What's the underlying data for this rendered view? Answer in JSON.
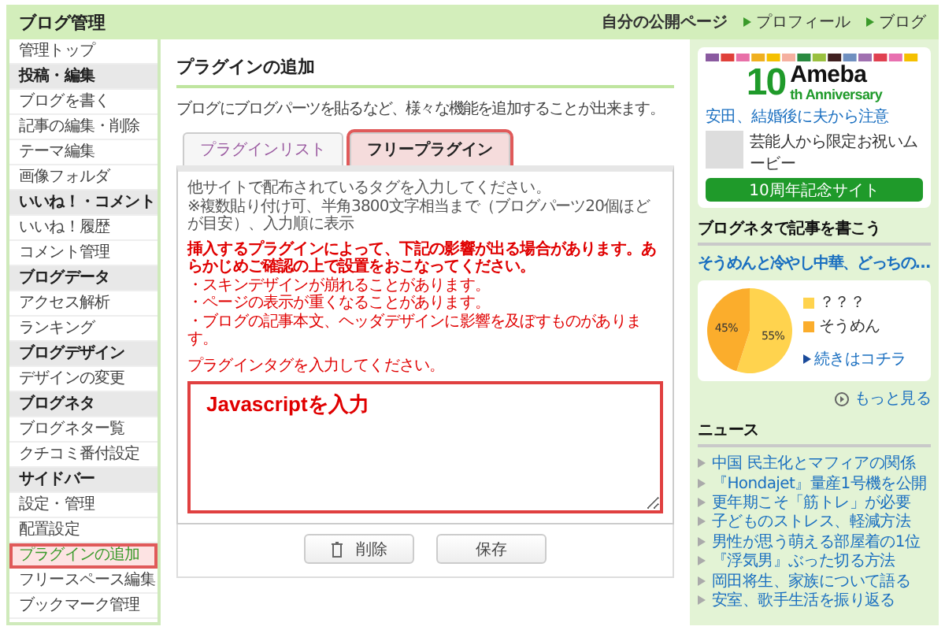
{
  "header": {
    "title": "ブログ管理",
    "links": [
      {
        "label": "自分の公開ページ",
        "kind": "plain"
      },
      {
        "label": "プロフィール",
        "kind": "arrow"
      },
      {
        "label": "ブログ",
        "kind": "arrow"
      }
    ]
  },
  "sidebar": {
    "items": [
      {
        "label": "管理トップ",
        "kind": "link",
        "selected": false,
        "highlighted": false
      },
      {
        "label": "投稿・編集",
        "kind": "header",
        "selected": false,
        "highlighted": false
      },
      {
        "label": "ブログを書く",
        "kind": "link",
        "selected": false,
        "highlighted": false
      },
      {
        "label": "記事の編集・削除",
        "kind": "link",
        "selected": false,
        "highlighted": false
      },
      {
        "label": "テーマ編集",
        "kind": "link",
        "selected": false,
        "highlighted": false
      },
      {
        "label": "画像フォルダ",
        "kind": "link",
        "selected": false,
        "highlighted": false
      },
      {
        "label": "いいね！・コメント",
        "kind": "header",
        "selected": false,
        "highlighted": false
      },
      {
        "label": "いいね！履歴",
        "kind": "link",
        "selected": false,
        "highlighted": false
      },
      {
        "label": "コメント管理",
        "kind": "link",
        "selected": false,
        "highlighted": false
      },
      {
        "label": "ブログデータ",
        "kind": "header",
        "selected": false,
        "highlighted": false
      },
      {
        "label": "アクセス解析",
        "kind": "link",
        "selected": false,
        "highlighted": false
      },
      {
        "label": "ランキング",
        "kind": "link",
        "selected": false,
        "highlighted": false
      },
      {
        "label": "ブログデザイン",
        "kind": "header",
        "selected": false,
        "highlighted": false
      },
      {
        "label": "デザインの変更",
        "kind": "link",
        "selected": false,
        "highlighted": false
      },
      {
        "label": "ブログネタ",
        "kind": "header",
        "selected": false,
        "highlighted": false
      },
      {
        "label": "ブログネター覧",
        "kind": "link",
        "selected": false,
        "highlighted": false
      },
      {
        "label": "クチコミ番付設定",
        "kind": "link",
        "selected": false,
        "highlighted": false
      },
      {
        "label": "サイドバー",
        "kind": "header",
        "selected": false,
        "highlighted": false
      },
      {
        "label": "設定・管理",
        "kind": "link",
        "selected": false,
        "highlighted": false
      },
      {
        "label": "配置設定",
        "kind": "link",
        "selected": false,
        "highlighted": false
      },
      {
        "label": "プラグインの追加",
        "kind": "link",
        "selected": true,
        "highlighted": true
      },
      {
        "label": "フリースペース編集",
        "kind": "link",
        "selected": false,
        "highlighted": false
      },
      {
        "label": "ブックマーク管理",
        "kind": "link",
        "selected": false,
        "highlighted": false
      }
    ]
  },
  "main": {
    "title": "プラグインの追加",
    "description": "ブログにブログパーツを貼るなど、様々な機能を追加することが出来ます。",
    "tabs": [
      {
        "label": "プラグインリスト",
        "selected": false,
        "highlighted": false
      },
      {
        "label": "フリープラグイン",
        "selected": true,
        "highlighted": true
      }
    ],
    "instructions": [
      "他サイトで配布されているタグを入力してください。",
      "※複数貼り付け可、半角3800文字相当まで（ブログパーツ20個ほどが目安）、入力順に表示"
    ],
    "warning": {
      "heading": "挿入するプラグインによって、下記の影響が出る場合があります。あらかじめご確認の上で設置をおこなってください。",
      "items": [
        "・スキンデザインが崩れることがあります。",
        "・ページの表示が重くなることがあります。",
        "・ブログの記事本文、ヘッダデザインに影響を及ぼすものがあります。"
      ]
    },
    "prompt": "プラグインタグを入力してください。",
    "editor": {
      "value": "Javascriptを入力",
      "highlighted": true
    },
    "buttons": [
      {
        "label": "削除",
        "kind": "delete"
      },
      {
        "label": "保存",
        "kind": "save"
      }
    ]
  },
  "right": {
    "banner": {
      "logo_number": "10",
      "logo_name": "Ameba",
      "logo_sub": "th Anniversary",
      "headline": "安田、結婚後に夫から注意",
      "caption": "芸能人から限定お祝いムービー",
      "button": "10周年記念サイト"
    },
    "neta": {
      "heading": "ブログネタで記事を書こう",
      "topic": "そうめんと冷やし中華、どっちの…",
      "chart_data": {
        "type": "pie",
        "legend": "right",
        "categories": [
          "？？？",
          "そうめん"
        ],
        "values": [
          55,
          45
        ],
        "colors": [
          "#ffd34e",
          "#fbad2c"
        ],
        "value_labels": [
          "55%",
          "45%"
        ]
      },
      "more_link": "続きはコチラ"
    },
    "more": "もっと見る",
    "news": {
      "heading": "ニュース",
      "items": [
        "中国 民主化とマフィアの関係",
        "『Hondajet』量産1号機を公開",
        "更年期こそ「筋トレ」が必要",
        "子どものストレス、軽減方法",
        "男性が思う萌える部屋着の1位",
        "『浮気男』ぶった切る方法",
        "岡田将生、家族について語る",
        "安室、歌手生活を振り返る"
      ]
    }
  }
}
